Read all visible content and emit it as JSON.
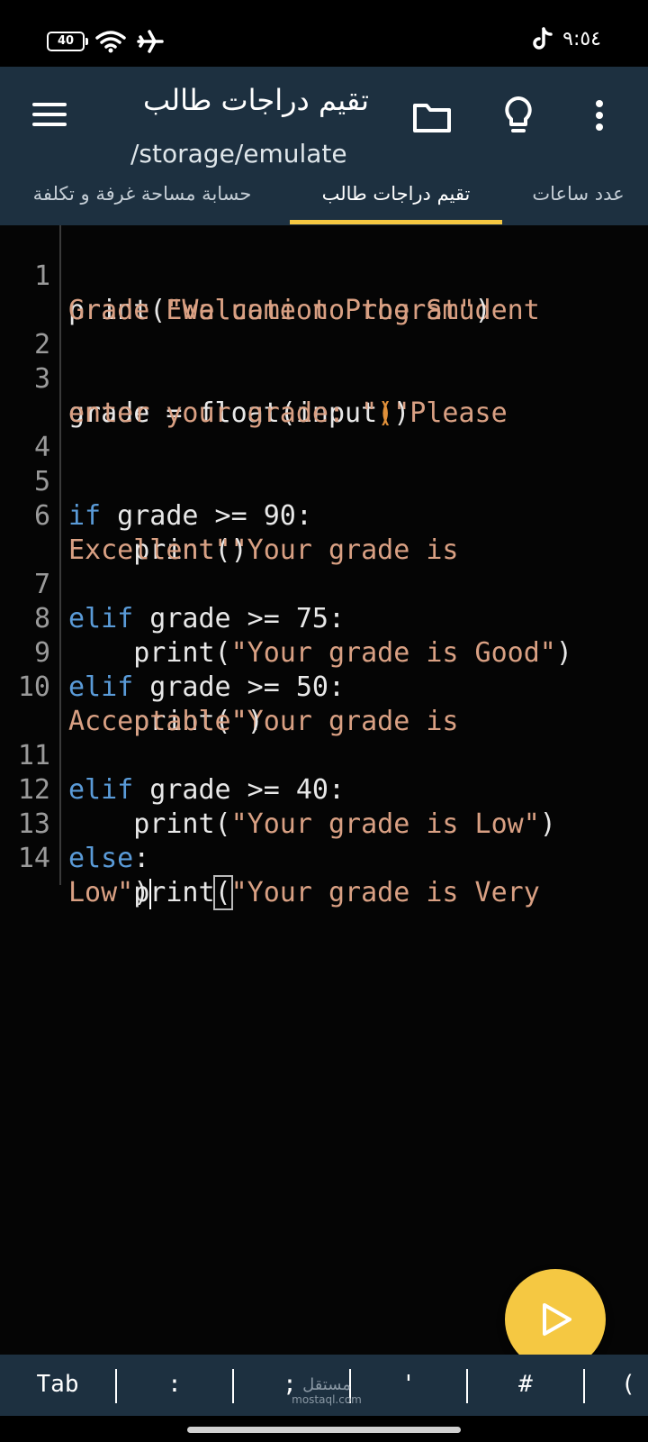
{
  "status_bar": {
    "battery": "40",
    "time": "٩:٥٤",
    "icons": [
      "battery-icon",
      "wifi-icon",
      "airplane-icon",
      "tiktok-icon"
    ]
  },
  "app_bar": {
    "title": "تقيم دراجات طالب",
    "subtitle": "/storage/emulate",
    "icons": [
      "menu-icon",
      "folder-icon",
      "lightbulb-icon",
      "more-vert-icon"
    ]
  },
  "tabs": [
    {
      "label": "حسابة مساحة غرفة و تكلفة"
    },
    {
      "label": "تقيم دراجات طالب",
      "active": true
    },
    {
      "label": "عدد ساعات"
    }
  ],
  "editor": {
    "lines": [
      {
        "n": "1",
        "code": "print(\"Welcome to the Student Grade Evaluation Program\")"
      },
      {
        "n": "2",
        "code": ""
      },
      {
        "n": "3",
        "code": "grade = float(input(\"Please enter your grade: \"))"
      },
      {
        "n": "4",
        "code": ""
      },
      {
        "n": "5",
        "code": "if grade >= 90:"
      },
      {
        "n": "6",
        "code": "    print(\"Your grade is Excellent\")"
      },
      {
        "n": "7",
        "code": "elif grade >= 75:"
      },
      {
        "n": "8",
        "code": "    print(\"Your grade is Good\")"
      },
      {
        "n": "9",
        "code": "elif grade >= 50:"
      },
      {
        "n": "10",
        "code": "    print(\"Your grade is Acceptable\")"
      },
      {
        "n": "11",
        "code": "elif grade >= 40:"
      },
      {
        "n": "12",
        "code": "    print(\"Your grade is Low\")"
      },
      {
        "n": "13",
        "code": "else:"
      },
      {
        "n": "14",
        "code": "    print(\"Your grade is Very Low\")"
      }
    ],
    "display": {
      "l1a": "print(",
      "l1s": "\"Welcome to the Student",
      "l1b": "Grade Evaluation Program\"",
      "l1e": ")",
      "l3a": "grade = float(input",
      "l3p": "(",
      "l3s": "\"Please",
      "l3b": "enter your grade: \"",
      "l3q": ")",
      "l3e": ")",
      "l5k": "if",
      "l5r": " grade >= 90:",
      "l6a": "    print(",
      "l6s": "\"Your grade is",
      "l6b": "Excellent\"",
      "l6e": ")",
      "l7k": "elif",
      "l7r": " grade >= 75:",
      "l8a": "    print(",
      "l8s": "\"Your grade is Good\"",
      "l8e": ")",
      "l9k": "elif",
      "l9r": " grade >= 50:",
      "l10a": "    print(",
      "l10s": "\"Your grade is",
      "l10b": "Acceptable\"",
      "l10e": ")",
      "l11k": "elif",
      "l11r": " grade >= 40:",
      "l12a": "    print(",
      "l12s": "\"Your grade is Low\"",
      "l12e": ")",
      "l13k": "else",
      "l13r": ":",
      "l14a": "    print",
      "l14p": "(",
      "l14s": "\"Your grade is Very",
      "l14b": "Low\"",
      "l14e": ")"
    }
  },
  "run_button": {
    "icon": "play-icon"
  },
  "keybar": {
    "keys": [
      "Tab",
      ":",
      ";",
      "'",
      "#",
      "("
    ]
  },
  "watermark": {
    "text": "مستقل",
    "sub": "mostaql.com"
  },
  "colors": {
    "appbar": "#1d3040",
    "accent": "#f5c842",
    "string": "#d9a083",
    "keyword": "#5a9bd8",
    "background": "#050505"
  }
}
